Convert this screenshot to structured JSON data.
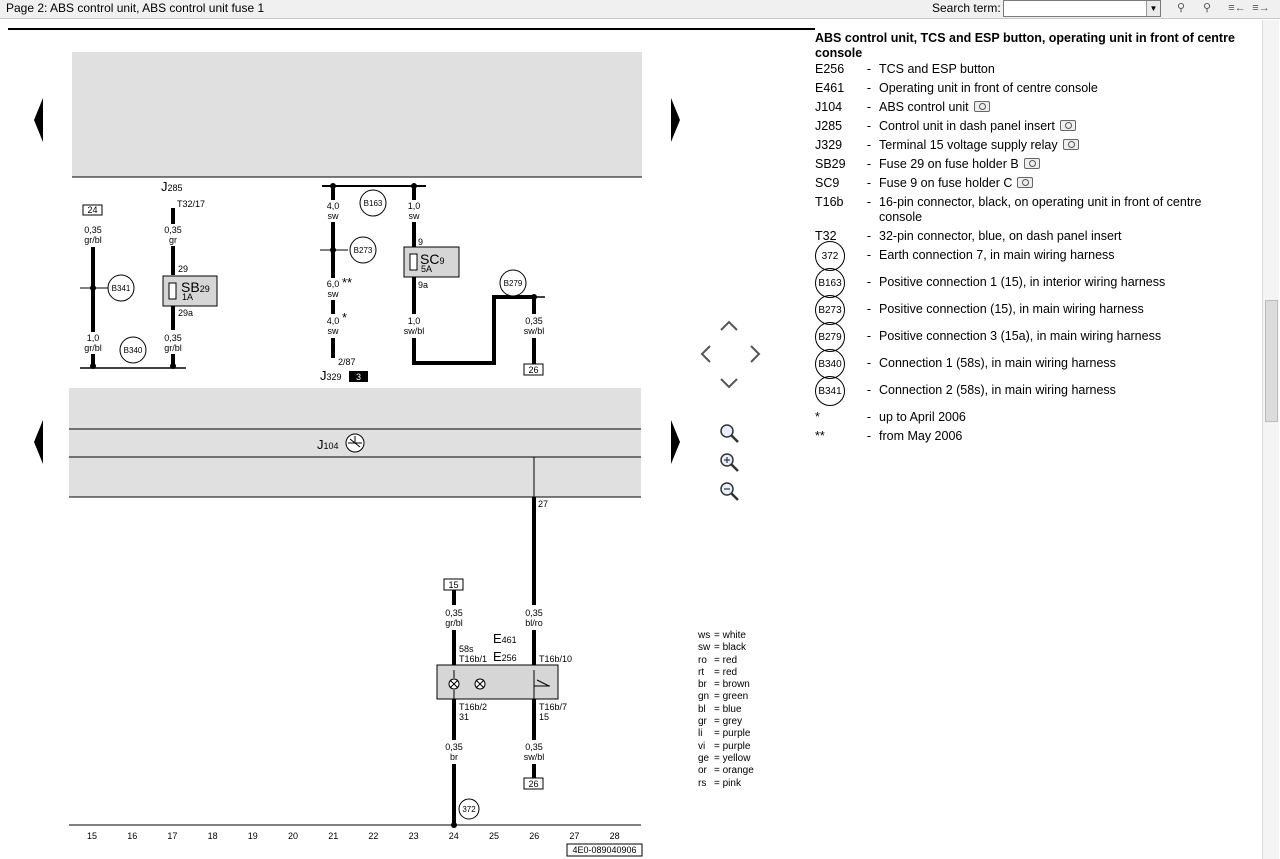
{
  "toolbar": {
    "title": "Page 2: ABS control unit, ABS control unit fuse 1",
    "search_label": "Search term:",
    "search_value": "",
    "buttons": [
      "find-icon",
      "find-next-icon",
      "page-back-icon",
      "page-forward-icon"
    ]
  },
  "legend": {
    "title": "ABS control unit, TCS and ESP button, operating unit in front of centre console",
    "items": [
      {
        "code": "E256",
        "desc": "TCS and ESP button",
        "photo": false
      },
      {
        "code": "E461",
        "desc": "Operating unit in front of centre console",
        "photo": false
      },
      {
        "code": "J104",
        "desc": "ABS control unit",
        "photo": true
      },
      {
        "code": "J285",
        "desc": "Control unit in dash panel insert",
        "photo": true
      },
      {
        "code": "J329",
        "desc": "Terminal 15 voltage supply relay",
        "photo": true
      },
      {
        "code": "SB29",
        "desc": "Fuse 29 on fuse holder B",
        "photo": true
      },
      {
        "code": "SC9",
        "desc": "Fuse 9 on fuse holder C",
        "photo": true
      },
      {
        "code": "T16b",
        "desc": "16-pin connector, black, on operating unit in front of centre console",
        "photo": false
      },
      {
        "code": "T32",
        "desc": "32-pin connector, blue, on dash panel insert",
        "photo": false
      },
      {
        "code": "372",
        "desc": "Earth connection 7, in main wiring harness",
        "circle": true
      },
      {
        "code": "B163",
        "desc": "Positive connection 1 (15), in interior wiring harness",
        "circle": true
      },
      {
        "code": "B273",
        "desc": "Positive connection (15), in main wiring harness",
        "circle": true
      },
      {
        "code": "B279",
        "desc": "Positive connection 3 (15a), in main wiring harness",
        "circle": true
      },
      {
        "code": "B340",
        "desc": "Connection 1 (58s), in main wiring harness",
        "circle": true
      },
      {
        "code": "B341",
        "desc": "Connection 2 (58s), in main wiring harness",
        "circle": true
      },
      {
        "code": "*",
        "desc": "up to April 2006",
        "photo": false
      },
      {
        "code": "**",
        "desc": "from May 2006",
        "photo": false
      }
    ]
  },
  "colors": [
    {
      "ab": "ws",
      "name": "white"
    },
    {
      "ab": "sw",
      "name": "black"
    },
    {
      "ab": "ro",
      "name": "red"
    },
    {
      "ab": "rt",
      "name": "red"
    },
    {
      "ab": "br",
      "name": "brown"
    },
    {
      "ab": "gn",
      "name": "green"
    },
    {
      "ab": "bl",
      "name": "blue"
    },
    {
      "ab": "gr",
      "name": "grey"
    },
    {
      "ab": "li",
      "name": "purple"
    },
    {
      "ab": "vi",
      "name": "purple"
    },
    {
      "ab": "ge",
      "name": "yellow"
    },
    {
      "ab": "or",
      "name": "orange"
    },
    {
      "ab": "rs",
      "name": "pink"
    }
  ],
  "diagram": {
    "tracks": [
      "15",
      "16",
      "17",
      "18",
      "19",
      "20",
      "21",
      "22",
      "23",
      "24",
      "25",
      "26",
      "27",
      "28"
    ],
    "doc_number": "4E0-089040906",
    "labels": {
      "j285": "J",
      "j285_sub": "285",
      "t32_17": "T32/17",
      "box24": "24",
      "w1_size": "0,35",
      "w1_col": "gr/bl",
      "w2_size": "0,35",
      "w2_col": "gr",
      "sb_pin29": "29",
      "sb_name": "SB",
      "sb_sub": "29",
      "sb_amp": "1A",
      "sb_pin29a": "29a",
      "w3_size": "0,35",
      "w3_col": "gr/bl",
      "w4_size": "1,0",
      "w4_col": "gr/bl",
      "b341": "B341",
      "b340": "B340",
      "b163": "B163",
      "b273": "B273",
      "w5_size": "4,0",
      "w5_col": "sw",
      "w6_size": "6,0",
      "w6_col": "sw",
      "star2": "**",
      "w7_size": "4,0",
      "w7_col": "sw",
      "star1": "*",
      "pin2_87": "2/87",
      "j329": "J",
      "j329_sub": "329",
      "tag3": "3",
      "w8_size": "1,0",
      "w8_col": "sw",
      "sc_pin9": "9",
      "sc_name": "SC",
      "sc_sub": "9",
      "sc_amp": "5A",
      "sc_pin9a": "9a",
      "w9_size": "1,0",
      "w9_col": "sw/bl",
      "b279": "B279",
      "w10_size": "0,35",
      "w10_col": "sw/bl",
      "box26a": "26",
      "j104": "J",
      "j104_sub": "104",
      "pin27": "27",
      "box15": "15",
      "w11_size": "0,35",
      "w11_col": "gr/bl",
      "w12_size": "0,35",
      "w12_col": "bl/ro",
      "e461": "E",
      "e461_sub": "461",
      "e256": "E",
      "e256_sub": "256",
      "p58s": "58s",
      "t16b1": "T16b/1",
      "t16b10": "T16b/10",
      "t16b2": "T16b/2",
      "p31": "31",
      "t16b7": "T16b/7",
      "p15": "15",
      "w13_size": "0,35",
      "w13_col": "br",
      "w14_size": "0,35",
      "w14_col": "sw/bl",
      "box26b": "26",
      "g372": "372"
    }
  }
}
